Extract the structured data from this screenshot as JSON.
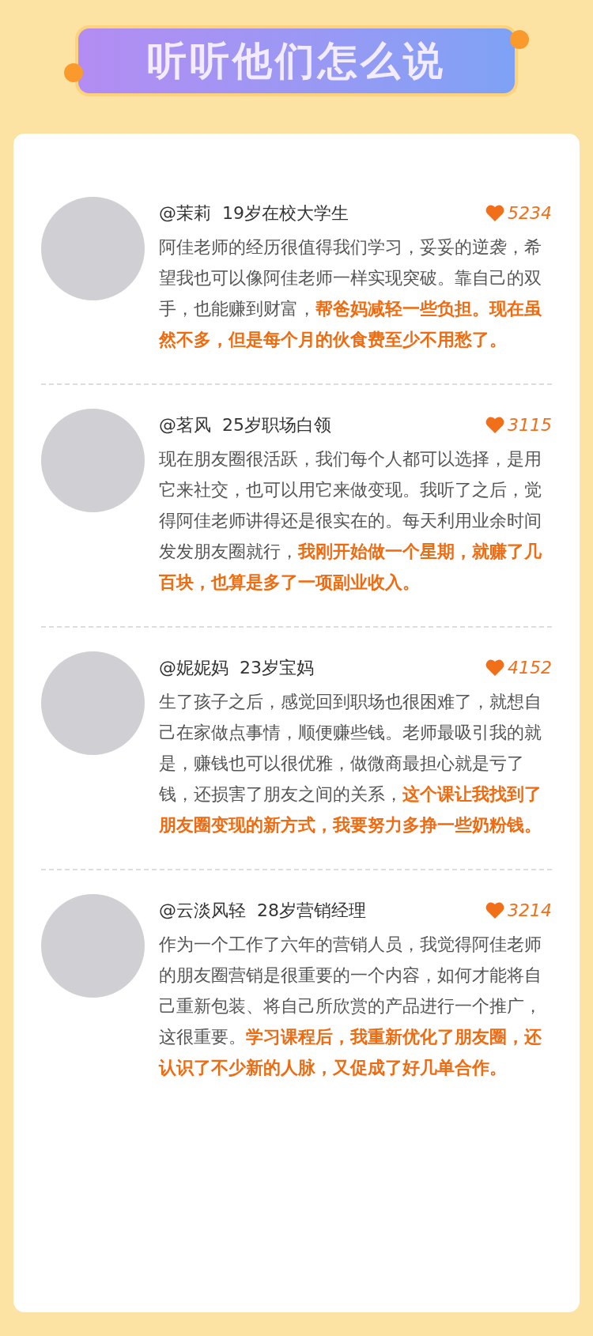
{
  "title": "听听他们怎么说",
  "testimonials": [
    {
      "name": "@茉莉",
      "tag": "19岁在校大学生",
      "likes": "5234",
      "text": "阿佳老师的经历很值得我们学习，妥妥的逆袭，希望我也可以像阿佳老师一样实现突破。靠自己的双手，也能赚到财富，**帮爸妈减轻一些负担。现在虽然不多，但是每个月的伙食费至少不用愁了。**"
    },
    {
      "name": "@茗风",
      "tag": "25岁职场白领",
      "likes": "3115",
      "text": "现在朋友圈很活跃，我们每个人都可以选择，是用它来社交，也可以用它来做变现。我听了之后，觉得阿佳老师讲得还是很实在的。每天利用业余时间发发朋友圈就行，**我刚开始做一个星期，就赚了几百块，也算是多了一项副业收入。**"
    },
    {
      "name": "@妮妮妈",
      "tag": "23岁宝妈",
      "likes": "4152",
      "text": "生了孩子之后，感觉回到职场也很困难了，就想自己在家做点事情，顺便赚些钱。老师最吸引我的就是，赚钱也可以很优雅，做微商最担心就是亏了钱，还损害了朋友之间的关系，**这个课让我找到了朋友圈变现的新方式，我要努力多挣一些奶粉钱。**"
    },
    {
      "name": "@云淡风轻",
      "tag": "28岁营销经理",
      "likes": "3214",
      "text": "作为一个工作了六年的营销人员，我觉得阿佳老师的朋友圈营销是很重要的一个内容，如何才能将自己重新包装、将自己所欣赏的产品进行一个推广，这很重要。**学习课程后，我重新优化了朋友圈，还认识了不少新的人脉，又促成了好几单合作。**"
    }
  ]
}
